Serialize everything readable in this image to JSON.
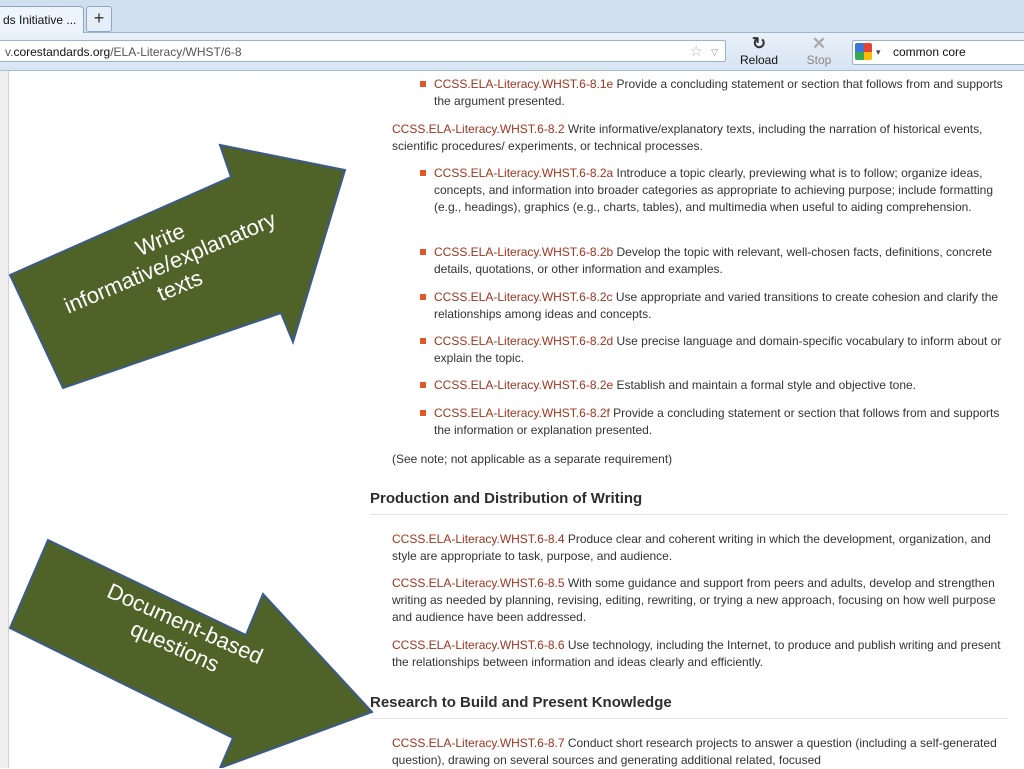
{
  "browser": {
    "tab_title": "ds Initiative ...",
    "new_tab": "+",
    "url_prefix": "v.",
    "url_domain": "corestandards.org",
    "url_path": "/ELA-Literacy/WHST/6-8",
    "reload_label": "Reload",
    "stop_label": "Stop",
    "search_value": "common core"
  },
  "standards_top": [
    {
      "code": "CCSS.ELA-Literacy.WHST.6-8.1e",
      "text": " Provide a concluding statement or section that follows from and supports the argument presented."
    }
  ],
  "standard_2": {
    "code": "CCSS.ELA-Literacy.WHST.6-8.2",
    "text": " Write informative/explanatory texts, including the narration of historical events, scientific procedures/ experiments, or technical processes."
  },
  "standard_2_subs": [
    {
      "code": "CCSS.ELA-Literacy.WHST.6-8.2a",
      "text": " Introduce a topic clearly, previewing what is to follow; organize ideas, concepts, and information into broader categories as appropriate to achieving purpose; include formatting (e.g., headings), graphics (e.g., charts, tables), and multimedia when useful to aiding comprehension."
    },
    {
      "code": "CCSS.ELA-Literacy.WHST.6-8.2b",
      "text": " Develop the topic with relevant, well-chosen facts, definitions, concrete details, quotations, or other information and examples."
    },
    {
      "code": "CCSS.ELA-Literacy.WHST.6-8.2c",
      "text": " Use appropriate and varied transitions to create cohesion and clarify the relationships among ideas and concepts."
    },
    {
      "code": "CCSS.ELA-Literacy.WHST.6-8.2d",
      "text": " Use precise language and domain-specific vocabulary to inform about or explain the topic."
    },
    {
      "code": "CCSS.ELA-Literacy.WHST.6-8.2e",
      "text": " Establish and maintain a formal style and objective tone."
    },
    {
      "code": "CCSS.ELA-Literacy.WHST.6-8.2f",
      "text": " Provide a concluding statement or section that follows from and supports the information or explanation presented."
    }
  ],
  "note_3": "(See note; not applicable as a separate requirement)",
  "heading_production": "Production and Distribution of Writing",
  "production": [
    {
      "code": "CCSS.ELA-Literacy.WHST.6-8.4",
      "text": " Produce clear and coherent writing in which the development, organization, and style are appropriate to task, purpose, and audience."
    },
    {
      "code": "CCSS.ELA-Literacy.WHST.6-8.5",
      "text": " With some guidance and support from peers and adults, develop and strengthen writing as needed by planning, revising, editing, rewriting, or trying a new approach, focusing on how well purpose and audience have been addressed."
    },
    {
      "code": "CCSS.ELA-Literacy.WHST.6-8.6",
      "text": " Use technology, including the Internet, to produce and publish writing and present the relationships between information and ideas clearly and efficiently."
    }
  ],
  "heading_research": "Research to Build and Present Knowledge",
  "research": [
    {
      "code": "CCSS.ELA-Literacy.WHST.6-8.7",
      "text": " Conduct short research projects to answer a question (including a self-generated question), drawing on several sources and generating additional related, focused"
    }
  ],
  "callouts": {
    "arrow1": [
      "Write",
      "informative/explanatory",
      "texts"
    ],
    "arrow2": [
      "Document-based",
      "questions"
    ]
  },
  "colors": {
    "arrow_fill": "#4f6228",
    "arrow_stroke": "#3c5a8c",
    "code_link": "#a0341f",
    "bullet": "#e0582a"
  }
}
